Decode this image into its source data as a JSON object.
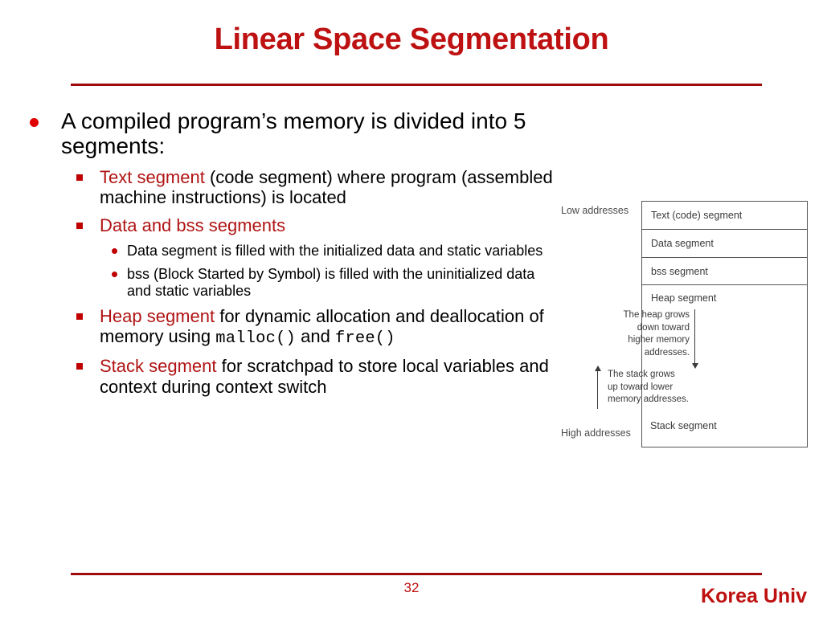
{
  "slide": {
    "title": "Linear Space Segmentation",
    "accent_color": "#BE1111",
    "rule_color": "#9E0B0B"
  },
  "content": {
    "bullet1": "A compiled program’s memory is divided into 5 segments:",
    "text_segment": {
      "label": "Text segment",
      "rest": " (code segment) where program (assembled machine instructions) is located"
    },
    "data_bss": {
      "label": "Data and bss segments",
      "sub": [
        "Data segment is filled with the initialized data and static variables",
        "bss (Block Started by Symbol) is filled with the uninitialized data and static variables"
      ]
    },
    "heap": {
      "label": "Heap segment",
      "rest_a": " for dynamic allocation and deallocation of memory using ",
      "code_a": "malloc()",
      "rest_b": " and ",
      "code_b": "free()"
    },
    "stack": {
      "label": "Stack segment",
      "rest": " for scratchpad to store local variables and context during context switch"
    }
  },
  "diagram": {
    "low_addresses": "Low addresses",
    "high_addresses": "High addresses",
    "rows": [
      "Text (code) segment",
      "Data segment",
      "bss segment",
      "Heap segment"
    ],
    "heap_note": "The heap grows\ndown toward\nhigher memory\naddresses.",
    "stack_note": "The stack grows\nup toward lower\nmemory addresses.",
    "stack_label": "Stack segment"
  },
  "footer": {
    "page_number": "32",
    "brand": "Korea Univ"
  }
}
